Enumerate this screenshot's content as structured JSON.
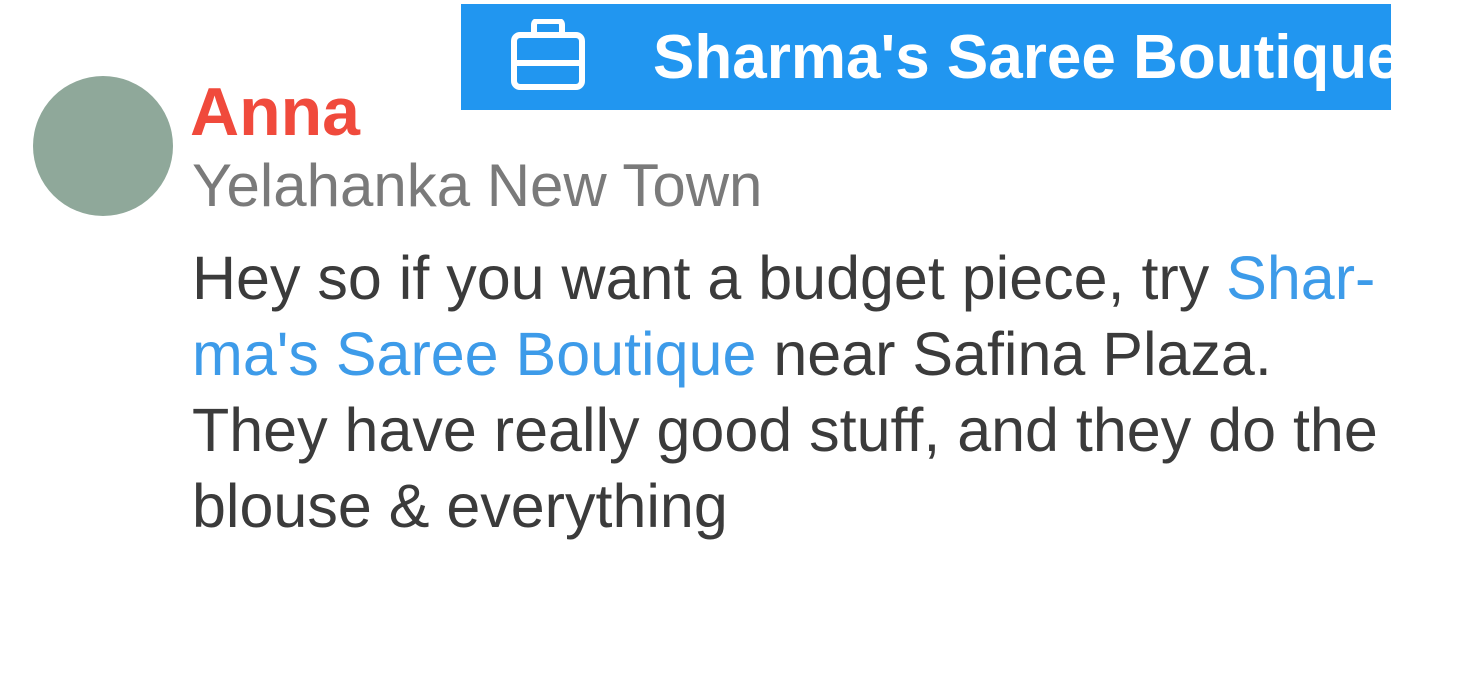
{
  "business_chip": {
    "icon": "briefcase-icon",
    "label": "Sharma's Saree Boutique",
    "background": "#2196f0"
  },
  "author": {
    "name": "Anna",
    "location": "Yelahanka New Town",
    "name_color": "#f04a3c",
    "avatar_color": "#8fa89a"
  },
  "message": {
    "line1_text": "Hey so if you want a budget piece, try ",
    "line1_link": "Shar-",
    "line2_link": "ma's Saree Boutique",
    "line2_text": " near Safina Plaza.",
    "line3_text": "They have really good stuff, and they do the",
    "line4_text": "blouse & everything",
    "link_color": "#3d9be9"
  }
}
